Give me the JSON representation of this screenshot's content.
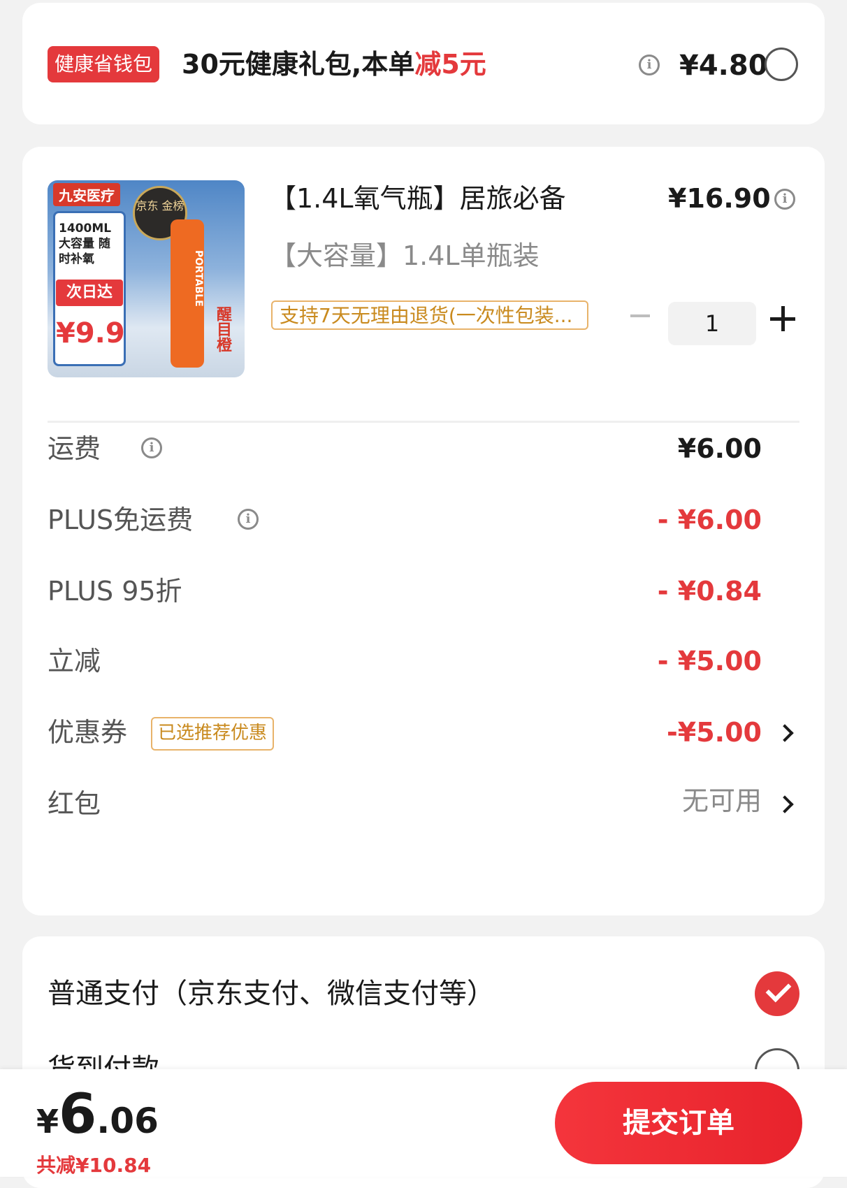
{
  "wallet": {
    "tag": "健康省钱包",
    "text_prefix": "30元健康礼包,本单",
    "text_highlight": "减5元",
    "price": "¥4.80"
  },
  "product": {
    "image": {
      "brand": "九安医疗",
      "badge": "京东 金榜",
      "capacity": "1400ML 大容量 随时补氧",
      "delivery": "次日达",
      "price": "¥9.9",
      "can_text": "PORTABLE",
      "side_text": "醒目橙"
    },
    "title": "【1.4L氧气瓶】居旅必备",
    "price": "¥16.90",
    "spec": "【大容量】1.4L单瓶装",
    "return_policy": "支持7天无理由退货(一次性包装...",
    "quantity": "1"
  },
  "fees": [
    {
      "label": "运费",
      "value": "¥6.00"
    },
    {
      "label": "PLUS免运费",
      "value": "- ¥6.00"
    },
    {
      "label": "PLUS 95折",
      "value": "- ¥0.84"
    },
    {
      "label": "立减",
      "value": "- ¥5.00"
    },
    {
      "label": "优惠券",
      "tag": "已选推荐优惠",
      "value": "-¥5.00"
    },
    {
      "label": "红包",
      "value": "无可用"
    }
  ],
  "payment": {
    "option1": "普通支付（京东支付、微信支付等）",
    "option2": "货到付款"
  },
  "bottom": {
    "currency": "¥",
    "total_int": "6",
    "total_dec": ".06",
    "saved": "共减¥10.84",
    "submit": "提交订单"
  },
  "colors": {
    "accent": "#e4393c",
    "tag_border": "#e8b36a",
    "tag_text": "#c98a1e",
    "background": "#f2f2f2"
  }
}
